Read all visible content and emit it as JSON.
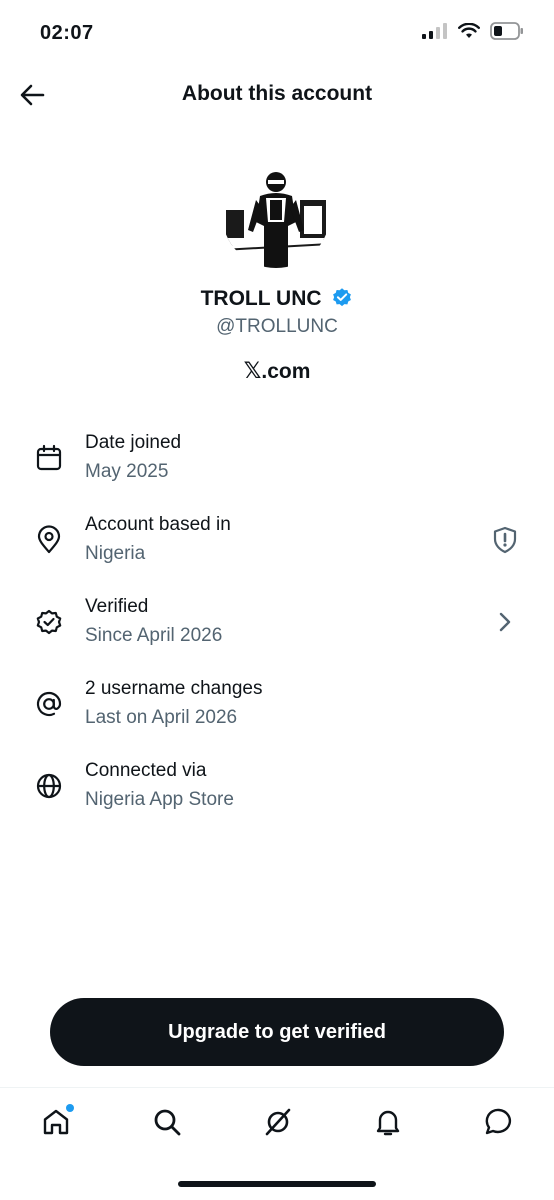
{
  "status_bar": {
    "time": "02:07"
  },
  "header": {
    "title": "About this account"
  },
  "profile": {
    "display_name": "TROLL UNC",
    "handle": "@TROLLUNC",
    "domain_mark": "𝕏",
    "domain_suffix": ".com"
  },
  "info_rows": [
    {
      "title": "Date joined",
      "subtitle": "May 2025",
      "icon": "calendar-icon"
    },
    {
      "title": "Account based in",
      "subtitle": "Nigeria",
      "icon": "location-pin-icon",
      "right_icon": "shield-alert-icon"
    },
    {
      "title": "Verified",
      "subtitle": "Since April 2026",
      "icon": "verified-badge-icon",
      "right_icon": "chevron-right-icon"
    },
    {
      "title": "2 username changes",
      "subtitle": "Last on April 2026",
      "icon": "at-sign-icon"
    },
    {
      "title": "Connected via",
      "subtitle": "Nigeria App Store",
      "icon": "globe-icon"
    }
  ],
  "cta": {
    "label": "Upgrade to get verified"
  },
  "tab_bar": [
    "home-icon",
    "search-icon",
    "grok-icon",
    "notifications-icon",
    "messages-icon"
  ],
  "colors": {
    "accent": "#1d9bf0",
    "text": "#0f1419",
    "secondary": "#536471",
    "button_bg": "#0f1419"
  }
}
